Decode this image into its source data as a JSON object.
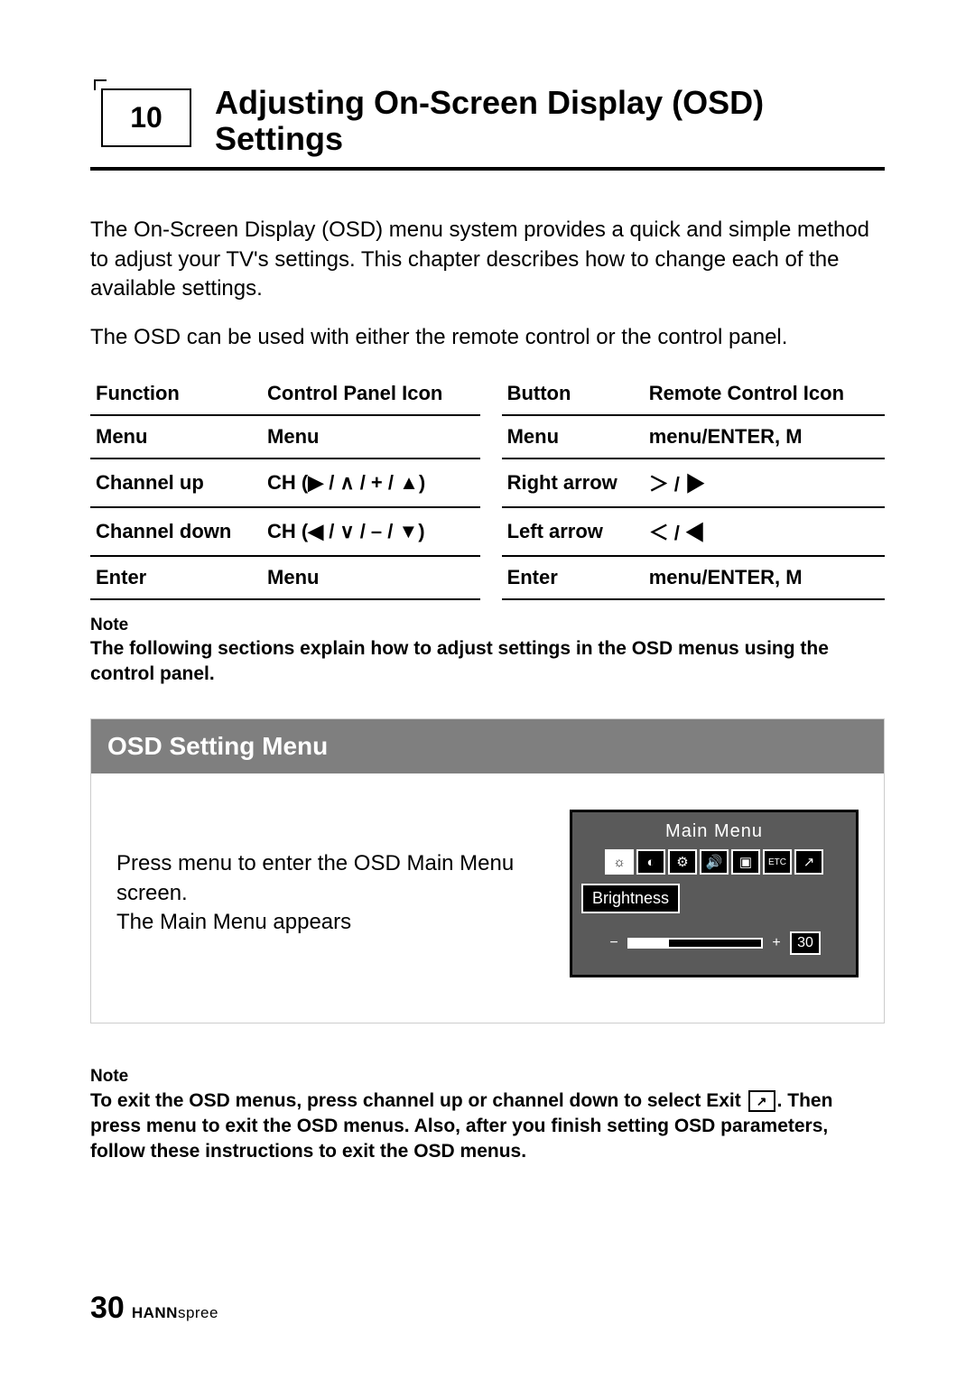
{
  "chapter": {
    "number": "10",
    "title": "Adjusting On-Screen Display (OSD) Settings"
  },
  "intro": {
    "p1": "The On-Screen Display (OSD) menu system provides a quick and simple method to adjust your TV's settings. This chapter describes how to change each of the available settings.",
    "p2": "The OSD can be used with either the remote control or the control panel."
  },
  "table": {
    "headers": {
      "function": "Function",
      "panel_icon": "Control Panel Icon",
      "button": "Button",
      "remote_icon": "Remote Control Icon"
    },
    "rows": [
      {
        "function": "Menu",
        "panel_icon": "Menu",
        "button": "Menu",
        "remote_icon": "menu/ENTER, M"
      },
      {
        "function": "Channel up",
        "panel_icon": "CH (▶ / ∧ / + / ▲)",
        "button": "Right arrow",
        "remote_icon": "＞ / ▶"
      },
      {
        "function": "Channel down",
        "panel_icon": "CH (◀ / ∨ / – / ▼)",
        "button": "Left arrow",
        "remote_icon": "＜ / ◀"
      },
      {
        "function": "Enter",
        "panel_icon": "Menu",
        "button": "Enter",
        "remote_icon": "menu/ENTER, M"
      }
    ]
  },
  "note1": {
    "label": "Note",
    "text": "The following sections explain how to adjust settings in the OSD menus using the control panel."
  },
  "osd_panel": {
    "header": "OSD Setting Menu",
    "instruction1": "Press menu to enter the OSD Main Menu screen.",
    "instruction2": "The Main Menu appears",
    "screenshot": {
      "title": "Main  Menu",
      "sub_label": "Brightness",
      "slider_value": "30",
      "icons": [
        "☼",
        "◐",
        "⚙",
        "🔊",
        "▣",
        "ETC",
        "↗"
      ]
    }
  },
  "note2": {
    "label": "Note",
    "text_before": "To exit the OSD menus, press channel up or channel down to select Exit ",
    "text_after": ". Then press menu to exit the OSD menus. Also, after you finish setting OSD parameters, follow these instructions to exit the OSD menus."
  },
  "footer": {
    "page": "30",
    "brand_bold": "HANN",
    "brand_rest": "spree"
  }
}
